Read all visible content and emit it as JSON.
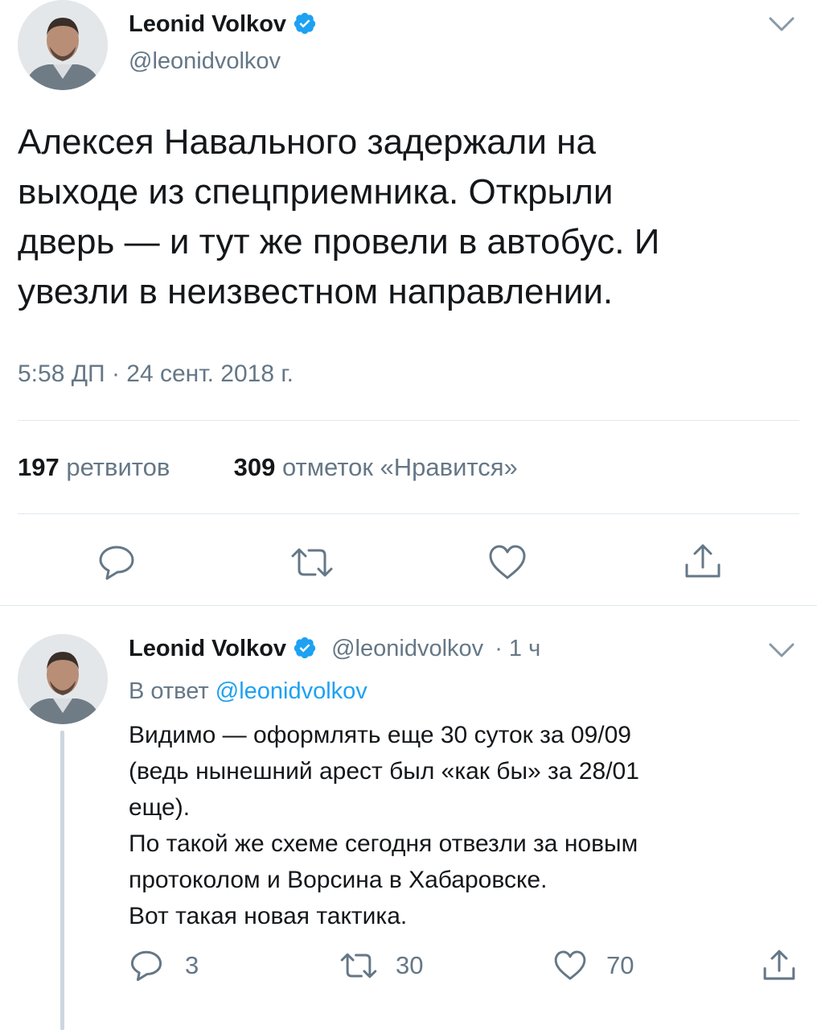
{
  "main_tweet": {
    "author_name": "Leonid Volkov",
    "author_handle": "@leonidvolkov",
    "text_lines": [
      "Алексея Навального задержали на",
      "выходе из спецприемника. Открыли",
      "дверь — и тут же провели в автобус. И",
      "увезли в неизвестном направлении."
    ],
    "timestamp": "5:58 ДП · 24 сент. 2018 г.",
    "retweets_count": "197",
    "retweets_label": "ретвитов",
    "likes_count": "309",
    "likes_label": "отметок «Нравится»"
  },
  "reply_tweet": {
    "author_name": "Leonid Volkov",
    "author_handle": "@leonidvolkov",
    "time_ago": "· 1 ч",
    "reply_prefix": "В ответ",
    "reply_to_handle": "@leonidvolkov",
    "text_lines": [
      "Видимо — оформлять еще 30 суток за 09/09",
      "(ведь нынешний арест был «как бы» за 28/01",
      "еще).",
      "По такой же схеме сегодня отвезли за новым",
      "протоколом и Ворсина в Хабаровске.",
      "Вот такая новая тактика."
    ],
    "reply_count": "3",
    "retweet_count": "30",
    "like_count": "70"
  },
  "colors": {
    "text_primary": "#14171a",
    "text_secondary": "#657786",
    "link_blue": "#1da1f2",
    "verified_blue": "#1da1f2",
    "divider": "#e1e8ed"
  },
  "icons": {
    "verified": "verified-badge-icon",
    "menu": "chevron-down-icon",
    "reply": "speech-bubble-icon",
    "retweet": "retweet-arrows-icon",
    "like": "heart-icon",
    "share": "share-upload-icon"
  }
}
